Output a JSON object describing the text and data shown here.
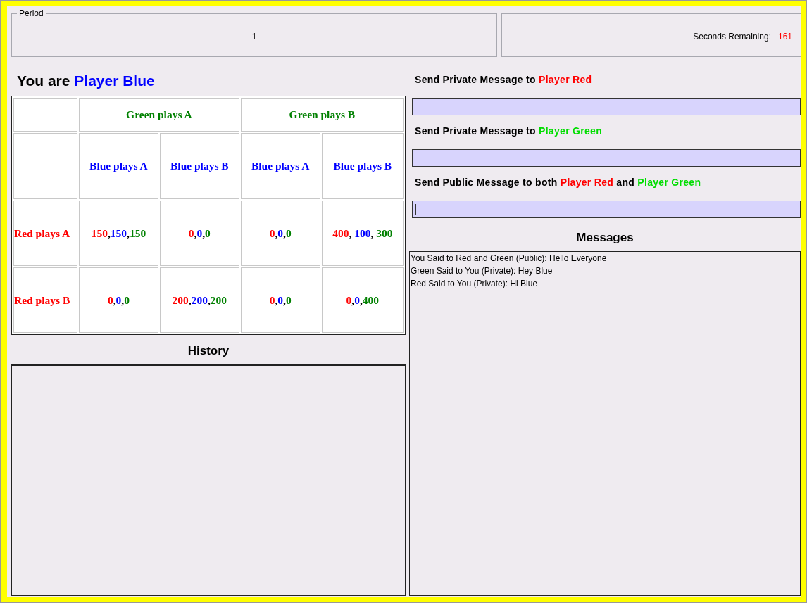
{
  "period": {
    "legend": "Period",
    "value": "1"
  },
  "timer": {
    "label": "Seconds Remaining:",
    "value": "161"
  },
  "player_heading": {
    "prefix": "You are",
    "player": "Player Blue",
    "color": "#0000ff"
  },
  "payoff_table": {
    "green_headers": [
      {
        "text": "Green plays A",
        "color": "#008000"
      },
      {
        "text": "Green plays B",
        "color": "#008000"
      }
    ],
    "blue_headers": [
      {
        "text": "Blue plays A",
        "color": "#0000ff"
      },
      {
        "text": "Blue plays B",
        "color": "#0000ff"
      },
      {
        "text": "Blue plays A",
        "color": "#0000ff"
      },
      {
        "text": "Blue plays B",
        "color": "#0000ff"
      }
    ],
    "rows": [
      {
        "label": "Red plays A",
        "color": "#ff0000",
        "cells": [
          [
            {
              "text": "150",
              "color": "#ff0000"
            },
            {
              "text": ","
            },
            {
              "text": "150",
              "color": "#0000ff"
            },
            {
              "text": ","
            },
            {
              "text": "150",
              "color": "#008000"
            }
          ],
          [
            {
              "text": "0",
              "color": "#ff0000"
            },
            {
              "text": ","
            },
            {
              "text": "0",
              "color": "#0000ff"
            },
            {
              "text": ","
            },
            {
              "text": "0",
              "color": "#008000"
            }
          ],
          [
            {
              "text": "0",
              "color": "#ff0000"
            },
            {
              "text": ","
            },
            {
              "text": "0",
              "color": "#0000ff"
            },
            {
              "text": ","
            },
            {
              "text": "0",
              "color": "#008000"
            }
          ],
          [
            {
              "text": "400",
              "color": "#ff0000"
            },
            {
              "text": ", "
            },
            {
              "text": "100",
              "color": "#0000ff"
            },
            {
              "text": ", "
            },
            {
              "text": "300",
              "color": "#008000"
            }
          ]
        ]
      },
      {
        "label": "Red plays B",
        "color": "#ff0000",
        "cells": [
          [
            {
              "text": "0",
              "color": "#ff0000"
            },
            {
              "text": ","
            },
            {
              "text": "0",
              "color": "#0000ff"
            },
            {
              "text": ","
            },
            {
              "text": "0",
              "color": "#008000"
            }
          ],
          [
            {
              "text": "200",
              "color": "#ff0000"
            },
            {
              "text": ","
            },
            {
              "text": "200",
              "color": "#0000ff"
            },
            {
              "text": ","
            },
            {
              "text": "200",
              "color": "#008000"
            }
          ],
          [
            {
              "text": "0",
              "color": "#ff0000"
            },
            {
              "text": ","
            },
            {
              "text": "0",
              "color": "#0000ff"
            },
            {
              "text": ","
            },
            {
              "text": "0",
              "color": "#008000"
            }
          ],
          [
            {
              "text": "0",
              "color": "#ff0000"
            },
            {
              "text": ","
            },
            {
              "text": "0",
              "color": "#0000ff"
            },
            {
              "text": ","
            },
            {
              "text": "400",
              "color": "#008000"
            }
          ]
        ]
      }
    ]
  },
  "history": {
    "title": "History"
  },
  "send_forms": [
    {
      "parts": [
        {
          "text": "Send Private Message to ",
          "color": "#000000"
        },
        {
          "text": "Player Red",
          "color": "#ff0000"
        }
      ],
      "focused": false
    },
    {
      "parts": [
        {
          "text": "Send Private Message to ",
          "color": "#000000"
        },
        {
          "text": "Player Green",
          "color": "#00dd00"
        }
      ],
      "focused": false
    },
    {
      "parts": [
        {
          "text": "Send Public Message to both ",
          "color": "#000000"
        },
        {
          "text": "Player Red",
          "color": "#ff0000"
        },
        {
          "text": " and ",
          "color": "#000000"
        },
        {
          "text": "Player Green",
          "color": "#00dd00"
        }
      ],
      "focused": true
    }
  ],
  "messages": {
    "title": "Messages",
    "lines": [
      "You Said to Red and Green (Public): Hello Everyone",
      "Green Said to You (Private): Hey Blue",
      "Red Said to You (Private): Hi Blue"
    ]
  }
}
